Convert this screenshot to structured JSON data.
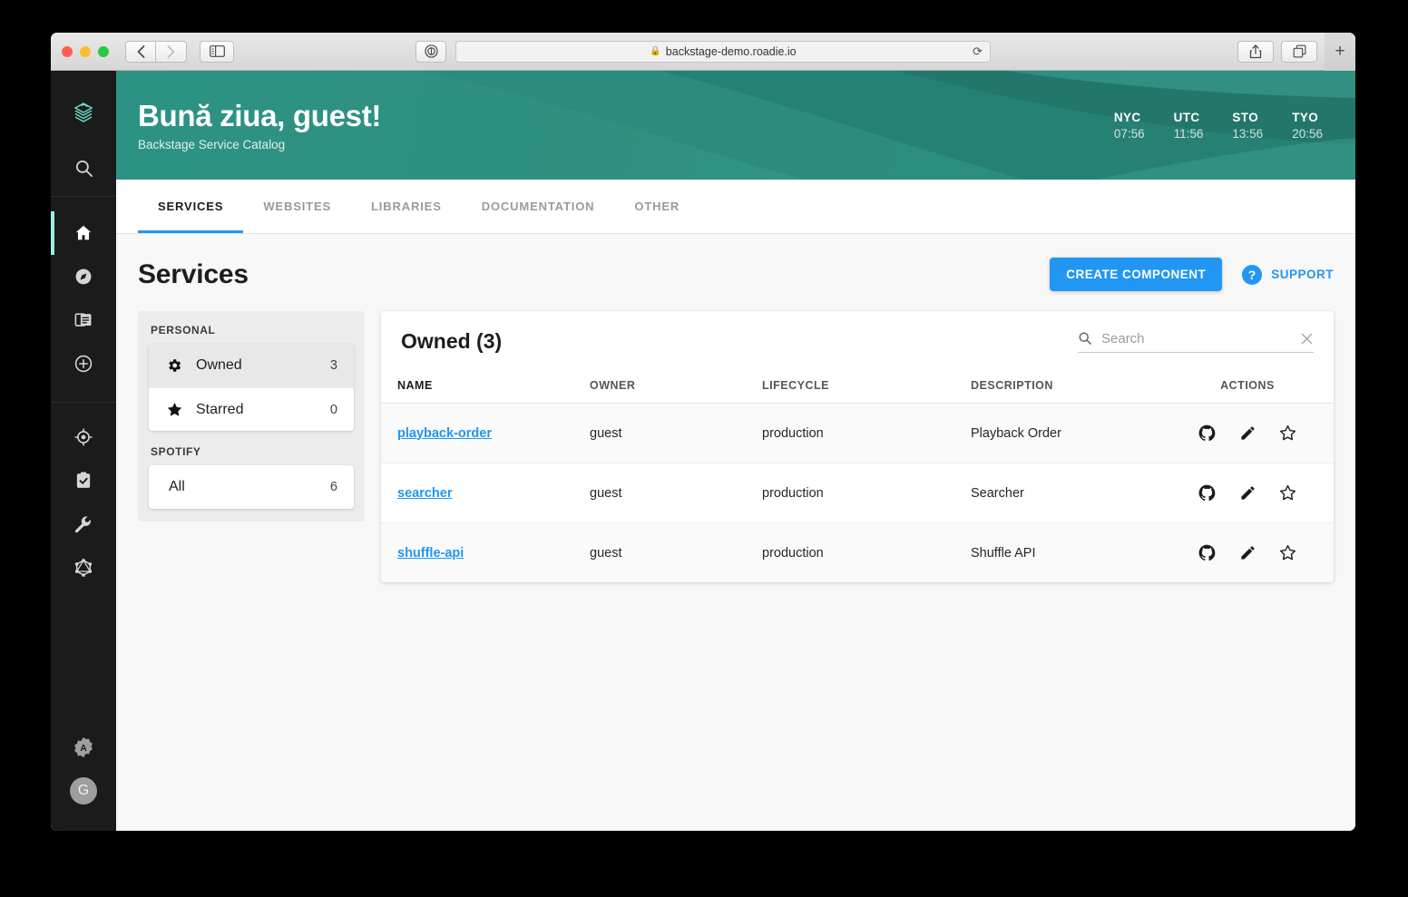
{
  "browser": {
    "url": "backstage-demo.roadie.io",
    "lock_icon": "lock-icon",
    "back_icon": "chevron-left-icon",
    "forward_icon": "chevron-right-icon",
    "sidebar_toggle_icon": "sidebar-toggle-icon",
    "reader_icon": "reader-view-icon",
    "reload_icon": "reload-icon",
    "share_icon": "share-icon",
    "tabs_overview_icon": "tabs-overview-icon",
    "new_tab_label": "+"
  },
  "rail": {
    "logo_icon": "backstage-logo-icon",
    "items": [
      {
        "name": "search",
        "icon": "search-icon"
      },
      {
        "name": "home",
        "icon": "home-icon",
        "active": true
      },
      {
        "name": "explore",
        "icon": "compass-icon",
        "active": false
      },
      {
        "name": "docs",
        "icon": "docs-icon",
        "active": false
      },
      {
        "name": "create",
        "icon": "plus-circle-icon",
        "active": false
      },
      {
        "name": "tech-radar",
        "icon": "target-icon",
        "active": false
      },
      {
        "name": "tech-insights",
        "icon": "clipboard-check-icon",
        "active": false
      },
      {
        "name": "tools",
        "icon": "wrench-icon",
        "active": false
      },
      {
        "name": "graphiql",
        "icon": "graphql-icon",
        "active": false
      }
    ],
    "settings_letter": "A",
    "avatar_letter": "G"
  },
  "banner": {
    "greeting": "Bună ziua, guest!",
    "subtitle": "Backstage Service Catalog",
    "gradient_from": "#2c9384",
    "gradient_to": "#37a391",
    "clocks": [
      {
        "label": "NYC",
        "time": "07:56"
      },
      {
        "label": "UTC",
        "time": "11:56"
      },
      {
        "label": "STO",
        "time": "13:56"
      },
      {
        "label": "TYO",
        "time": "20:56"
      }
    ]
  },
  "tabs": [
    {
      "label": "SERVICES",
      "active": true
    },
    {
      "label": "WEBSITES",
      "active": false
    },
    {
      "label": "LIBRARIES",
      "active": false
    },
    {
      "label": "DOCUMENTATION",
      "active": false
    },
    {
      "label": "OTHER",
      "active": false
    }
  ],
  "main": {
    "title": "Services",
    "create_button": "CREATE COMPONENT",
    "support_label": "SUPPORT",
    "support_icon": "help-circle-icon",
    "accent_color": "#2196f3"
  },
  "filters": {
    "groups": [
      {
        "label": "PERSONAL",
        "rows": [
          {
            "name": "Owned",
            "count": "3",
            "icon": "gear-icon",
            "selected": true
          },
          {
            "name": "Starred",
            "count": "0",
            "icon": "star-filled-icon",
            "selected": false
          }
        ]
      },
      {
        "label": "SPOTIFY",
        "rows": [
          {
            "name": "All",
            "count": "6",
            "icon": null,
            "selected": false
          }
        ]
      }
    ]
  },
  "table": {
    "title": "Owned (3)",
    "search": {
      "value": "",
      "placeholder": "Search",
      "icon": "search-icon",
      "clear_icon": "close-icon"
    },
    "columns": [
      "NAME",
      "OWNER",
      "LIFECYCLE",
      "DESCRIPTION",
      "ACTIONS"
    ],
    "rows": [
      {
        "name": "playback-order",
        "owner": "guest",
        "lifecycle": "production",
        "description": "Playback Order",
        "actions": [
          "github-icon",
          "edit-pencil-icon",
          "star-outline-icon"
        ]
      },
      {
        "name": "searcher",
        "owner": "guest",
        "lifecycle": "production",
        "description": "Searcher",
        "actions": [
          "github-icon",
          "edit-pencil-icon",
          "star-outline-icon"
        ]
      },
      {
        "name": "shuffle-api",
        "owner": "guest",
        "lifecycle": "production",
        "description": "Shuffle API",
        "actions": [
          "github-icon",
          "edit-pencil-icon",
          "star-outline-icon"
        ]
      }
    ]
  }
}
